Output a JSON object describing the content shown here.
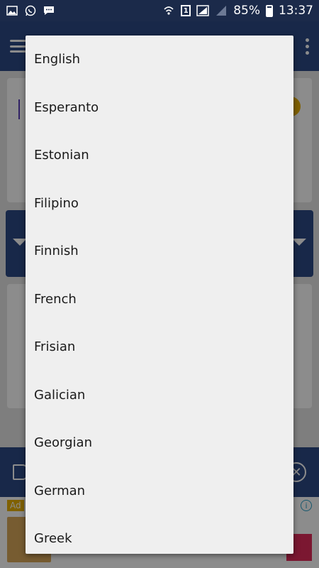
{
  "status_bar": {
    "battery_percent": "85%",
    "time": "13:37",
    "sim_slot": "1"
  },
  "ad": {
    "label": "Ad",
    "info_icon": "i"
  },
  "dropdown": {
    "options": [
      "English",
      "Esperanto",
      "Estonian",
      "Filipino",
      "Finnish",
      "French",
      "Frisian",
      "Galician",
      "Georgian",
      "German",
      "Greek"
    ]
  },
  "colors": {
    "app_bar": "#2d4a86",
    "status_bar": "#1b2a4a",
    "dropdown_bg": "#efefef",
    "accent_yellow": "#e9b100"
  }
}
